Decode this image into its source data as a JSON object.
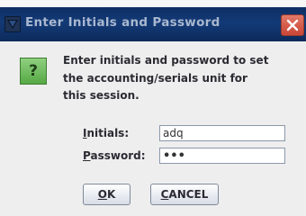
{
  "dialog": {
    "title": "Enter Initials and Password",
    "message_lines": [
      "Enter initials and password to set",
      "the accounting/serials unit for",
      "this session."
    ],
    "icon": "question-icon",
    "icon_glyph": "?"
  },
  "form": {
    "initials_label_mnemonic": "I",
    "initials_label_rest": "nitials:",
    "initials_value": "adq",
    "password_label_mnemonic": "P",
    "password_label_rest": "assword:",
    "password_mask": "•••"
  },
  "buttons": {
    "ok_mnemonic": "O",
    "ok_rest": "K",
    "cancel_mnemonic": "C",
    "cancel_rest": "ANCEL"
  },
  "colors": {
    "titlebar": "#133a77",
    "title_text": "#a9b8cf",
    "close_button": "#d55a4a",
    "question_icon": "#57a946",
    "dialog_bg": "#eeeeee"
  }
}
